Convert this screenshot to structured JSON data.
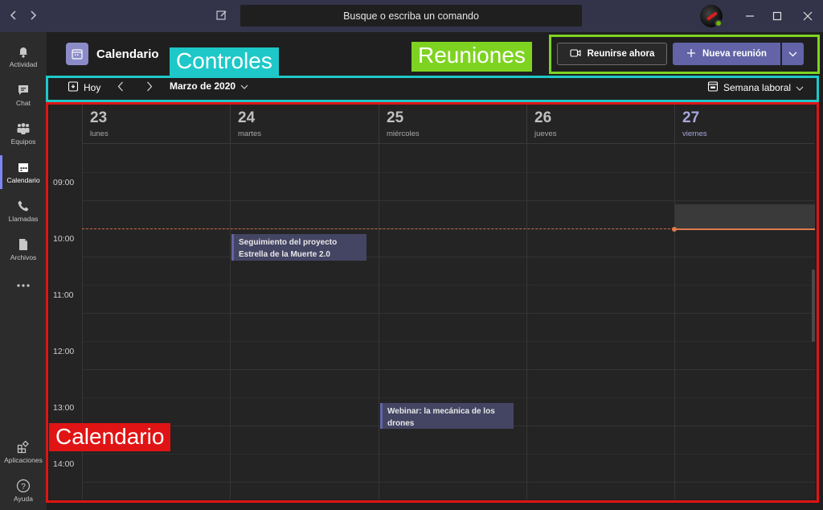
{
  "titlebar": {
    "search_placeholder": "Busque o escriba un comando"
  },
  "rail": {
    "items": [
      {
        "label": "Actividad",
        "icon": "bell-icon"
      },
      {
        "label": "Chat",
        "icon": "chat-icon"
      },
      {
        "label": "Equipos",
        "icon": "teams-icon"
      },
      {
        "label": "Calendario",
        "icon": "calendar-icon"
      },
      {
        "label": "Llamadas",
        "icon": "phone-icon"
      },
      {
        "label": "Archivos",
        "icon": "file-icon"
      },
      {
        "label": "...",
        "icon": "more-icon"
      },
      {
        "label": "Aplicaciones",
        "icon": "apps-icon"
      },
      {
        "label": "Ayuda",
        "icon": "help-icon"
      }
    ]
  },
  "header": {
    "title": "Calendario",
    "join_now": "Reunirse ahora",
    "new_meeting": "Nueva reunión"
  },
  "toolbar": {
    "today": "Hoy",
    "month": "Marzo de 2020",
    "view": "Semana laboral"
  },
  "calendar": {
    "days": [
      {
        "num": "23",
        "name": "lunes"
      },
      {
        "num": "24",
        "name": "martes"
      },
      {
        "num": "25",
        "name": "miércoles"
      },
      {
        "num": "26",
        "name": "jueves"
      },
      {
        "num": "27",
        "name": "viernes"
      }
    ],
    "times": [
      "09:00",
      "10:00",
      "11:00",
      "12:00",
      "13:00",
      "14:00"
    ],
    "events": [
      {
        "title": "Seguimiento del proyecto Estrella de la Muerte 2.0"
      },
      {
        "title": "Webinar: la mecánica de los drones"
      }
    ]
  },
  "annotations": {
    "controles": "Controles",
    "reuniones": "Reuniones",
    "calendario": "Calendario"
  },
  "colors": {
    "accent": "#6264a7",
    "controles": "#1ec8c8",
    "reuniones": "#7ed321",
    "calendario": "#e01414"
  }
}
